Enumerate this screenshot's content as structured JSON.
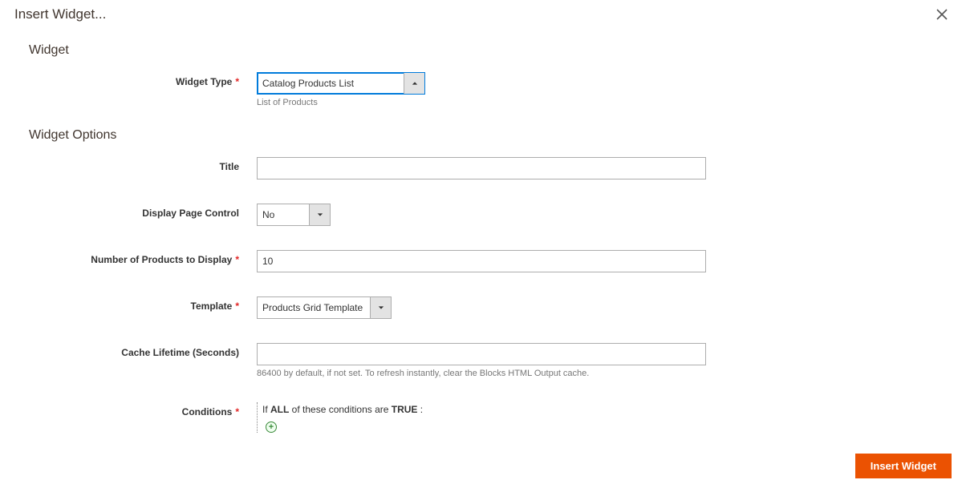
{
  "modal": {
    "title": "Insert Widget...",
    "close_label": "Close"
  },
  "sections": {
    "widget_title": "Widget",
    "options_title": "Widget Options"
  },
  "fields": {
    "widget_type": {
      "label": "Widget Type",
      "value": "Catalog Products List",
      "hint": "List of Products"
    },
    "title": {
      "label": "Title",
      "value": ""
    },
    "display_page_control": {
      "label": "Display Page Control",
      "value": "No"
    },
    "num_products": {
      "label": "Number of Products to Display",
      "value": "10"
    },
    "template": {
      "label": "Template",
      "value": "Products Grid Template"
    },
    "cache_lifetime": {
      "label": "Cache Lifetime (Seconds)",
      "value": "",
      "hint": "86400 by default, if not set. To refresh instantly, clear the Blocks HTML Output cache."
    },
    "conditions": {
      "label": "Conditions",
      "prefix": "If ",
      "aggregator": "ALL",
      "middle": " of these conditions are ",
      "value": "TRUE",
      "suffix": " :"
    }
  },
  "footer": {
    "submit_label": "Insert Widget"
  }
}
